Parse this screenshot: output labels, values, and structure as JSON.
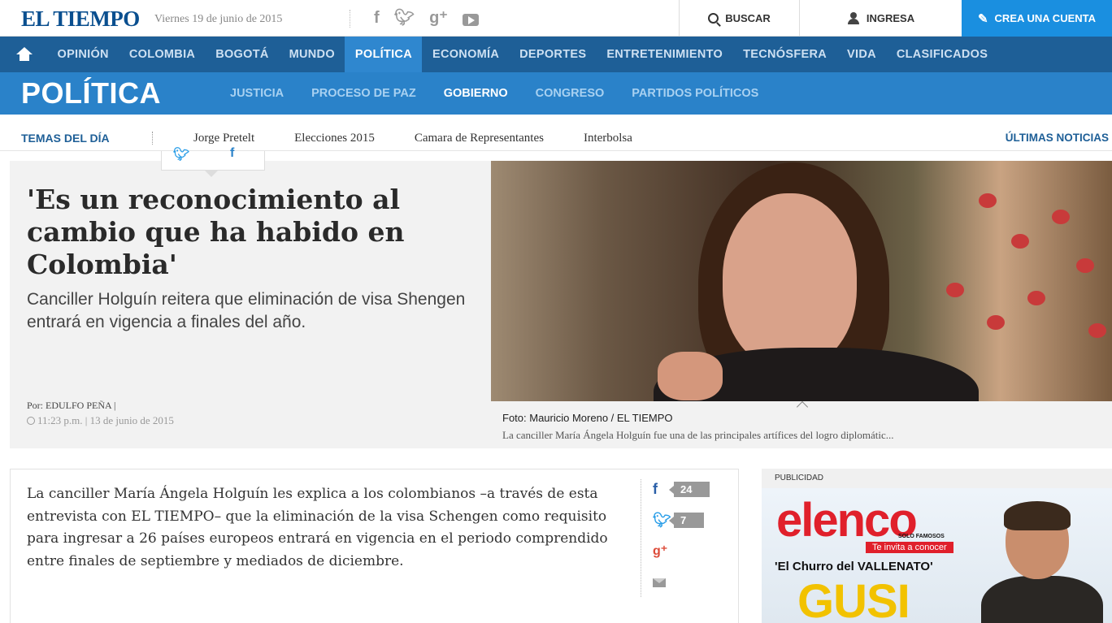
{
  "topbar": {
    "logo": "EL TIEMPO",
    "date": "Viernes 19 de junio de 2015",
    "social_icons": [
      "facebook-icon",
      "twitter-icon",
      "google-plus-icon",
      "youtube-icon"
    ],
    "search_label": "BUSCAR",
    "login_label": "INGRESA",
    "create_account_label": "CREA UNA CUENTA"
  },
  "main_nav": {
    "items": [
      {
        "label": "OPINIÓN",
        "active": false
      },
      {
        "label": "COLOMBIA",
        "active": false
      },
      {
        "label": "BOGOTÁ",
        "active": false
      },
      {
        "label": "MUNDO",
        "active": false
      },
      {
        "label": "POLÍTICA",
        "active": true
      },
      {
        "label": "ECONOMÍA",
        "active": false
      },
      {
        "label": "DEPORTES",
        "active": false
      },
      {
        "label": "ENTRETENIMIENTO",
        "active": false
      },
      {
        "label": "TECNÓSFERA",
        "active": false
      },
      {
        "label": "VIDA",
        "active": false
      },
      {
        "label": "CLASIFICADOS",
        "active": false
      }
    ]
  },
  "section": {
    "title": "POLÍTICA",
    "subnav": [
      {
        "label": "JUSTICIA",
        "active": false
      },
      {
        "label": "PROCESO DE PAZ",
        "active": false
      },
      {
        "label": "GOBIERNO",
        "active": true
      },
      {
        "label": "CONGRESO",
        "active": false
      },
      {
        "label": "PARTIDOS POLÍTICOS",
        "active": false
      }
    ]
  },
  "temas": {
    "label": "TEMAS DEL DÍA",
    "items": [
      "Jorge Pretelt",
      "Elecciones 2015",
      "Camara de Representantes",
      "Interbolsa"
    ],
    "ultimas": "ÚLTIMAS NOTICIAS"
  },
  "hero": {
    "headline": "'Es un reconocimiento al cambio que ha habido en Colombia'",
    "subhead": "Canciller Holguín reitera que eliminación de visa Shengen entrará en vigencia a finales del año.",
    "byline_prefix": "Por:",
    "author": "EDULFO PEÑA |",
    "timestamp": "11:23 p.m. | 13 de junio de 2015",
    "photo_credit": "Foto: Mauricio Moreno / EL TIEMPO",
    "photo_caption": "La canciller María Ángela Holguín fue una de las principales artífices del logro diplomátic..."
  },
  "article": {
    "lead": "La canciller María Ángela Holguín les explica a los colombianos –a través de esta entrevista con EL TIEMPO– que la eliminación de la visa Schengen como requisito para ingresar a 26 países europeos entrará en vigencia en el periodo comprendido entre finales de septiembre y mediados de diciembre.",
    "share": {
      "facebook_count": "24",
      "twitter_count": "7"
    }
  },
  "ad": {
    "label": "PUBLICIDAD",
    "brand": "elenco",
    "brand_sub": "SOLO FAMOSOS",
    "invite": "Te invita a conocer",
    "tagline": "'El Churro del VALLENATO'",
    "name": "GUSI"
  },
  "colors": {
    "nav_blue": "#1e5f97",
    "section_blue": "#2a82c9",
    "create_account_blue": "#1a8fe0",
    "ad_red": "#e0202b"
  }
}
